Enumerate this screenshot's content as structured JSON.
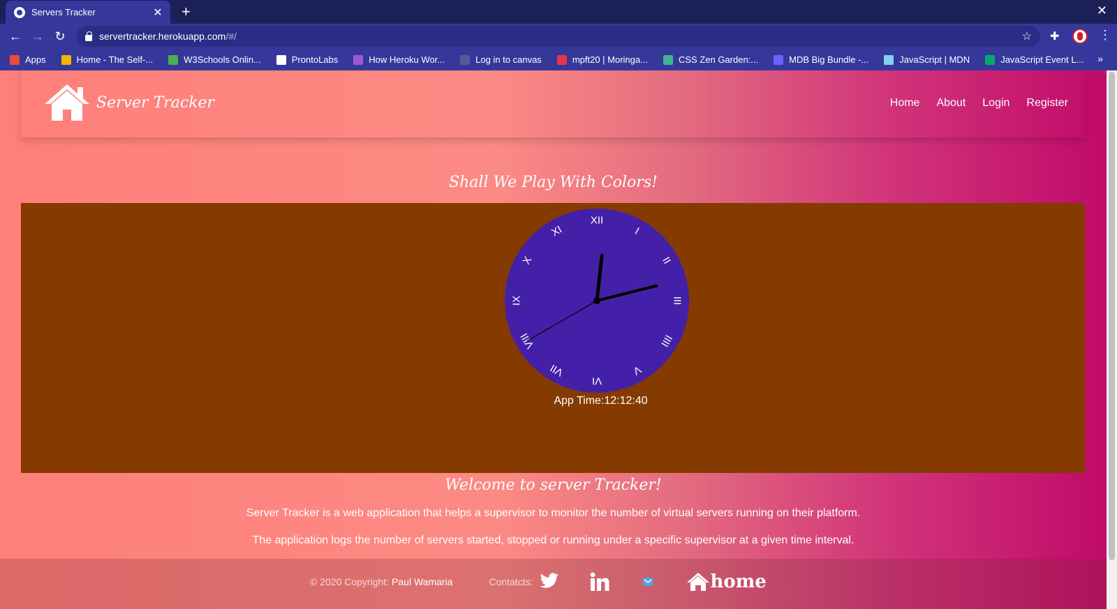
{
  "browser": {
    "tab_title": "Servers Tracker",
    "new_tab": "+",
    "close_tab": "✕",
    "url_host": "servertracker.herokuapp.com",
    "url_path": "/#/",
    "bookmarks": [
      {
        "label": "Apps",
        "color": "#e94b3c"
      },
      {
        "label": "Home - The Self-...",
        "color": "#f5b400"
      },
      {
        "label": "W3Schools Onlin...",
        "color": "#4caf50"
      },
      {
        "label": "ProntoLabs",
        "color": "#ffffff"
      },
      {
        "label": "How Heroku Wor...",
        "color": "#9b59d0"
      },
      {
        "label": "Log in to canvas",
        "color": "#555a9e"
      },
      {
        "label": "mpft20 | Moringa...",
        "color": "#e8334a"
      },
      {
        "label": "CSS Zen Garden:...",
        "color": "#3fb68e"
      },
      {
        "label": "MDB Big Bundle -...",
        "color": "#6c63ff"
      },
      {
        "label": "JavaScript | MDN",
        "color": "#83d0f2"
      },
      {
        "label": "JavaScript Event L...",
        "color": "#04aa6d"
      }
    ]
  },
  "site": {
    "brand": "Server Tracker",
    "menu": [
      "Home",
      "About",
      "Login",
      "Register"
    ],
    "clock_heading": "Shall We Play With Colors!",
    "clock": {
      "numerals": [
        "XII",
        "I",
        "II",
        "III",
        "IIII",
        "V",
        "VI",
        "VII",
        "VIII",
        "IX",
        "X",
        "XI"
      ],
      "hour": 12,
      "minute": 12,
      "second": 40,
      "face_color": "#4420a8",
      "panel_color": "#853b00"
    },
    "app_time": "App Time:12:12:40",
    "welcome_heading": "Welcome to server Tracker!",
    "para1": "Server Tracker is a web application that helps a supervisor to monitor the number of virtual servers running on their platform.",
    "para2": "The application logs the number of servers started, stopped or running under a specific supervisor at a given time interval."
  },
  "footer": {
    "copyright": "© 2020 Copyright:",
    "author": "Paul Wamaria",
    "contacts": "Contatcts:",
    "home_label": "home"
  }
}
